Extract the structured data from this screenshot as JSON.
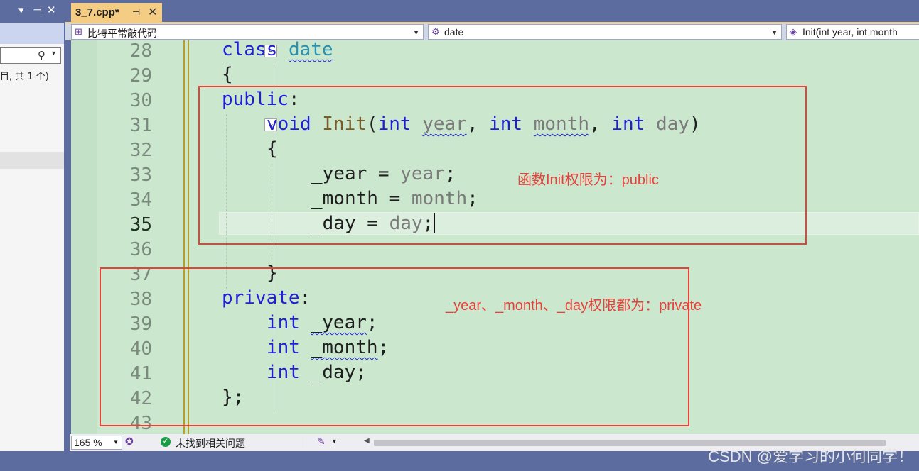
{
  "left_panel": {
    "status_text": "目, 共 1 个)",
    "icons": [
      "chevron-down-icon",
      "pin-icon",
      "close-icon",
      "search-icon"
    ]
  },
  "tabs": [
    {
      "label": "3_7.cpp*",
      "active": true
    }
  ],
  "nav": {
    "project": "比特平常敲代码",
    "scope": "date",
    "member": "Init(int year, int month"
  },
  "editor": {
    "lines": [
      {
        "num": "28",
        "text": "class date"
      },
      {
        "num": "29",
        "text": "{"
      },
      {
        "num": "30",
        "text": "public:"
      },
      {
        "num": "31",
        "text": "void Init(int year, int month, int day)"
      },
      {
        "num": "32",
        "text": "{"
      },
      {
        "num": "33",
        "text": "_year = year;"
      },
      {
        "num": "34",
        "text": "_month = month;"
      },
      {
        "num": "35",
        "text": "_day = day;"
      },
      {
        "num": "36",
        "text": ""
      },
      {
        "num": "37",
        "text": "}"
      },
      {
        "num": "38",
        "text": "private:"
      },
      {
        "num": "39",
        "text": "int _year;"
      },
      {
        "num": "40",
        "text": "int _month;"
      },
      {
        "num": "41",
        "text": "int _day;"
      },
      {
        "num": "42",
        "text": "};"
      },
      {
        "num": "43",
        "text": ""
      }
    ],
    "current_line": "35",
    "colors": {
      "keyword": "#1f1fd6",
      "type": "#2b91af",
      "function": "#7a5c28",
      "parameter": "#7a7a7a",
      "background": "#cbe8cf"
    }
  },
  "annotations": [
    {
      "text": "函数Init权限为：public",
      "color": "#e8413a"
    },
    {
      "text": "_year、_month、_day权限都为：private",
      "color": "#e8413a"
    }
  ],
  "status_bar": {
    "zoom": "165 %",
    "issues": "未找到相关问题"
  },
  "watermark": "CSDN @爱学习的小何同学！"
}
